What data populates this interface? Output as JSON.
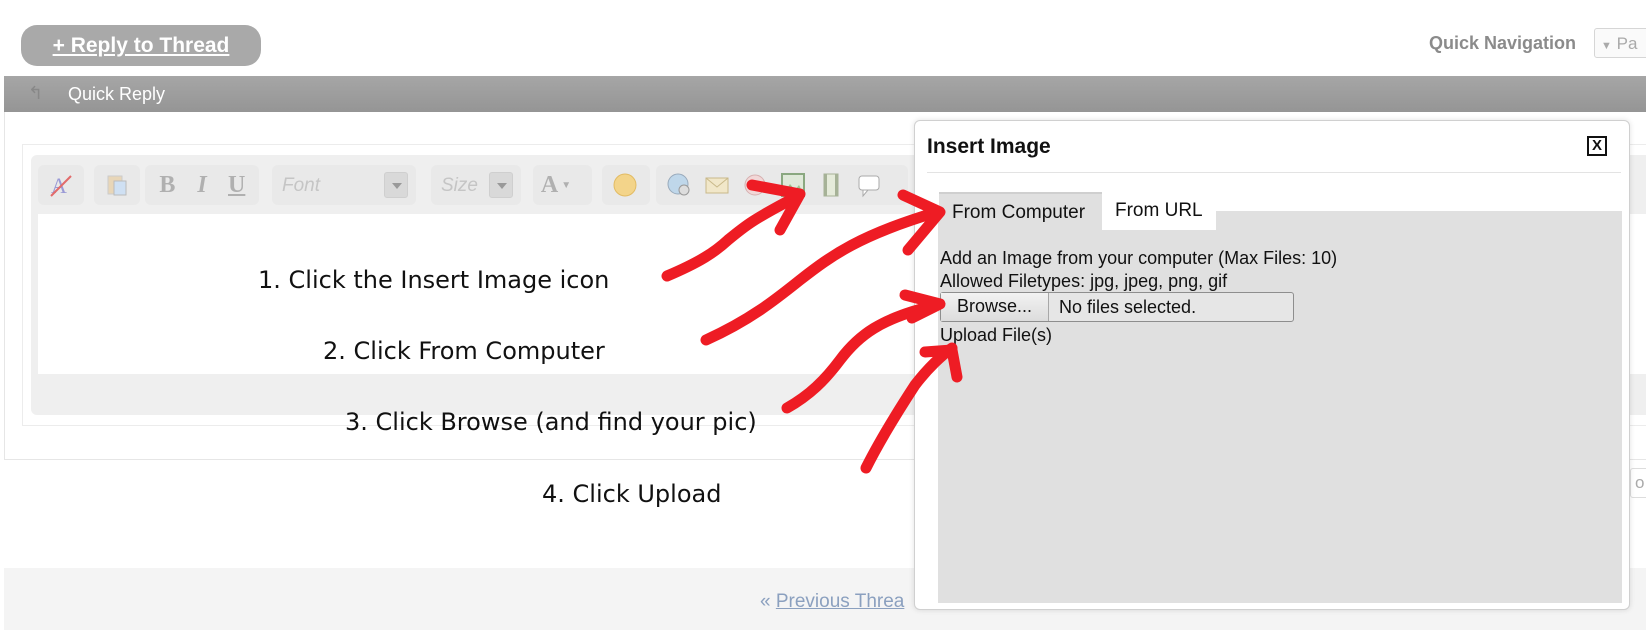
{
  "top": {
    "reply_button": "+ Reply to Thread",
    "quick_nav_label": "Quick Navigation",
    "quick_nav_value": "Pa"
  },
  "quick_reply": {
    "title": "Quick Reply",
    "toolbar": {
      "font_placeholder": "Font",
      "size_placeholder": "Size",
      "bold": "B",
      "italic": "I",
      "underline": "U",
      "text_color": "A"
    }
  },
  "instructions": [
    "1. Click the Insert Image icon",
    "2.  Click From Computer",
    "3.  Click Browse (and find your pic)",
    "4.  Click Upload"
  ],
  "dialog": {
    "title": "Insert Image",
    "close": "X",
    "tabs": [
      "From Computer",
      "From URL"
    ],
    "line1": "Add an Image from your computer (Max Files: 10)",
    "line2": "Allowed Filetypes: jpg, jpeg, png, gif",
    "browse": "Browse...",
    "file_status": "No files selected.",
    "upload": "Upload File(s)"
  },
  "bottom": {
    "prefix": "« ",
    "prev_thread": "Previous Threa",
    "side_stub": "o"
  },
  "colors": {
    "arrow": "#ee1c24",
    "header_gray": "#9e9e9e",
    "panel_gray": "#e0e0e0",
    "link": "#8ba0bf"
  }
}
